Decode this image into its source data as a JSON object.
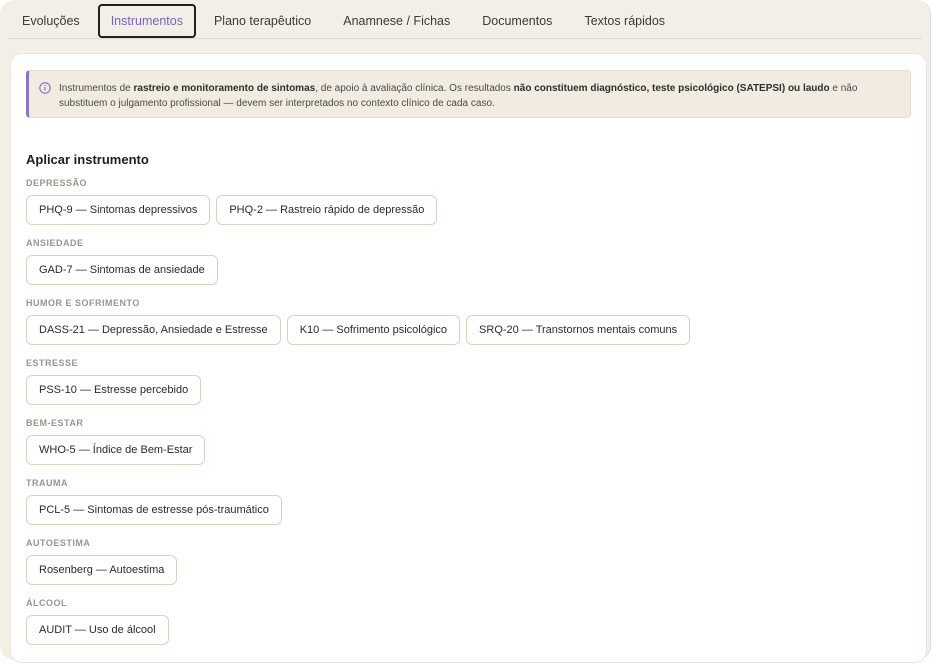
{
  "tabs": [
    {
      "label": "Evoluções",
      "active": false
    },
    {
      "label": "Instrumentos",
      "active": true
    },
    {
      "label": "Plano terapêutico",
      "active": false
    },
    {
      "label": "Anamnese / Fichas",
      "active": false
    },
    {
      "label": "Documentos",
      "active": false
    },
    {
      "label": "Textos rápidos",
      "active": false
    }
  ],
  "notice": {
    "icon": "info-icon",
    "t1": "Instrumentos de ",
    "b1": "rastreio e monitoramento de sintomas",
    "t2": ", de apoio à avaliação clínica. Os resultados ",
    "b2": "não constituem diagnóstico, teste psicológico (SATEPSI) ou laudo",
    "t3": " e não substituem o julgamento profissional — devem ser interpretados no contexto clínico de cada caso."
  },
  "section_title": "Aplicar instrumento",
  "groups": [
    {
      "label": "DEPRESSÃO",
      "items": [
        "PHQ-9 — Sintomas depressivos",
        "PHQ-2 — Rastreio rápido de depressão"
      ]
    },
    {
      "label": "ANSIEDADE",
      "items": [
        "GAD-7 — Sintomas de ansiedade"
      ]
    },
    {
      "label": "HUMOR E SOFRIMENTO",
      "items": [
        "DASS-21 — Depressão, Ansiedade e Estresse",
        "K10 — Sofrimento psicológico",
        "SRQ-20 — Transtornos mentais comuns"
      ]
    },
    {
      "label": "ESTRESSE",
      "items": [
        "PSS-10 — Estresse percebido"
      ]
    },
    {
      "label": "BEM-ESTAR",
      "items": [
        "WHO-5 — Índice de Bem-Estar"
      ]
    },
    {
      "label": "TRAUMA",
      "items": [
        "PCL-5 — Sintomas de estresse pós-traumático"
      ]
    },
    {
      "label": "AUTOESTIMA",
      "items": [
        "Rosenberg — Autoestima"
      ]
    },
    {
      "label": "ÁLCOOL",
      "items": [
        "AUDIT — Uso de álcool"
      ]
    }
  ],
  "colors": {
    "accent": "#7b61c4",
    "notice_bg": "#f1ebe2",
    "page_bg": "#f3efe7"
  }
}
